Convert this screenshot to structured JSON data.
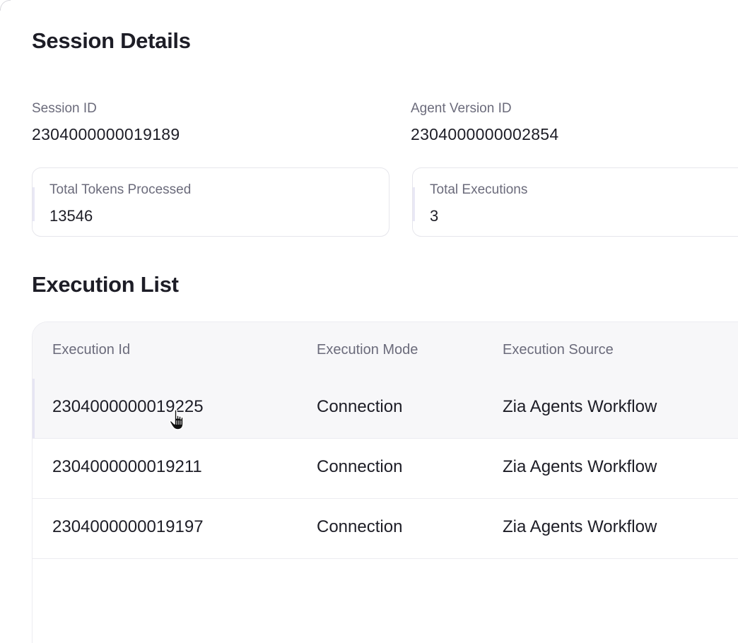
{
  "header": {
    "title": "Session Details"
  },
  "session": {
    "id_label": "Session ID",
    "id_value": "2304000000019189",
    "agent_label": "Agent Version ID",
    "agent_value": "2304000000002854"
  },
  "stats": {
    "tokens_label": "Total Tokens Processed",
    "tokens_value": "13546",
    "executions_label": "Total Executions",
    "executions_value": "3"
  },
  "executions": {
    "title": "Execution List",
    "columns": [
      "Execution Id",
      "Execution Mode",
      "Execution Source"
    ],
    "rows": [
      [
        "2304000000019225",
        "Connection",
        "Zia Agents Workflow"
      ],
      [
        "2304000000019211",
        "Connection",
        "Zia Agents Workflow"
      ],
      [
        "2304000000019197",
        "Connection",
        "Zia Agents Workflow"
      ]
    ]
  },
  "icons": {
    "cursor": "hand-pointer-icon"
  }
}
